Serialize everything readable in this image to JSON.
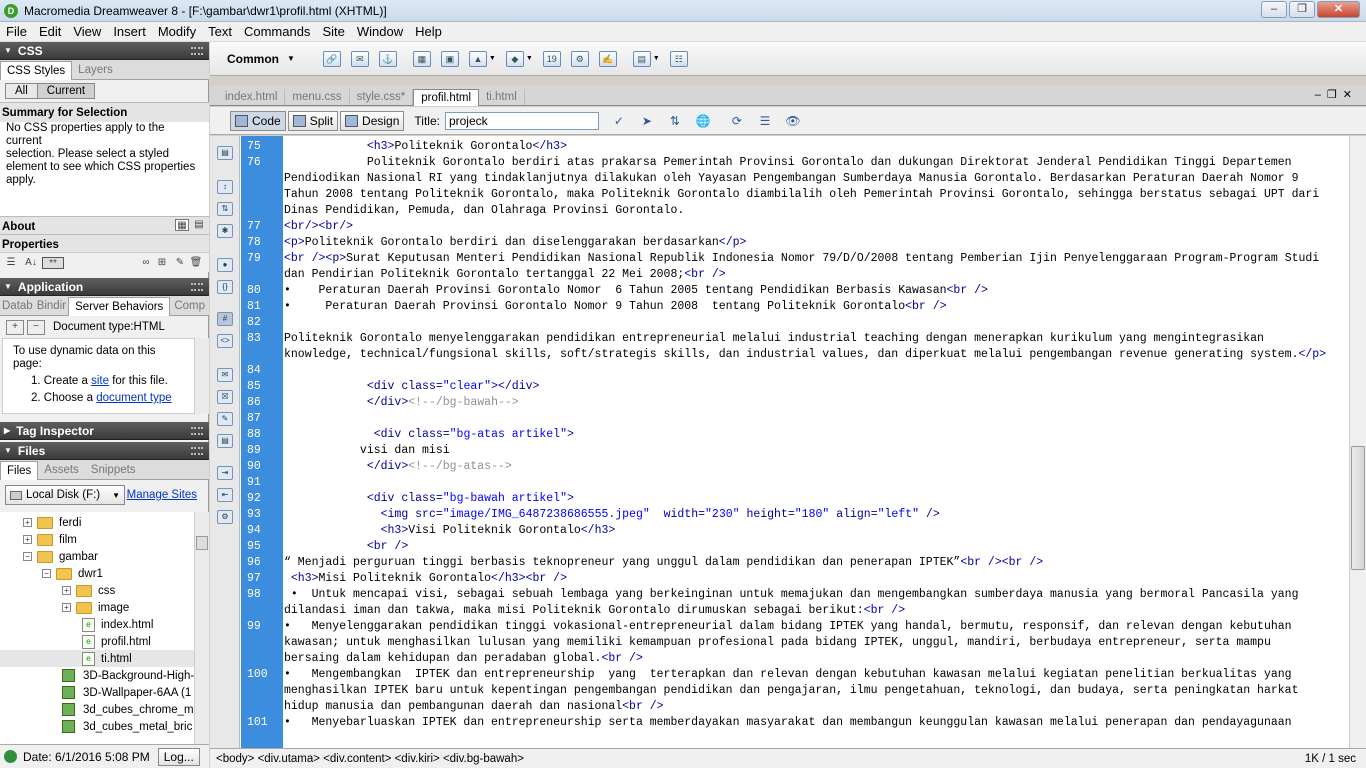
{
  "window": {
    "title": "Macromedia Dreamweaver 8 - [F:\\gambar\\dwr1\\profil.html (XHTML)]"
  },
  "menu": [
    "File",
    "Edit",
    "View",
    "Insert",
    "Modify",
    "Text",
    "Commands",
    "Site",
    "Window",
    "Help"
  ],
  "css_panel": {
    "header": "CSS",
    "tabs": [
      "CSS Styles",
      "Layers"
    ],
    "toggle": [
      "All",
      "Current"
    ],
    "summary_title": "Summary for Selection",
    "summary_lines": [
      "No CSS properties apply to the current",
      "selection.  Please select a styled",
      "element to see which CSS properties",
      "apply."
    ],
    "about": "About",
    "properties": "Properties"
  },
  "application_panel": {
    "header": "Application",
    "tabs": [
      "Datab",
      "Bindir",
      "Server Behaviors",
      "Comp"
    ],
    "doc_type": "Document type:HTML",
    "intro_lines": [
      "To use dynamic data on this",
      "page:"
    ],
    "step1_pre": "1.  Create a ",
    "step1_link": "site",
    "step1_post": " for this file.",
    "step2_pre": "2.  Choose a ",
    "step2_link": "document type"
  },
  "tag_inspector": {
    "header": "Tag Inspector"
  },
  "files_panel": {
    "header": "Files",
    "tabs": [
      "Files",
      "Assets",
      "Snippets"
    ],
    "disk": "Local Disk (F:)",
    "manage_sites": "Manage Sites",
    "tree": [
      "ferdi",
      "film",
      "gambar",
      "dwr1",
      "css",
      "image",
      "index.html",
      "profil.html",
      "ti.html",
      "3D-Background-High-",
      "3D-Wallpaper-6AA (1",
      "3d_cubes_chrome_m",
      "3d_cubes_metal_bric"
    ],
    "date": "Date: 6/1/2016 5:08 PM",
    "log": "Log..."
  },
  "insert_bar": {
    "category": "Common"
  },
  "doc_tabs": [
    "index.html",
    "menu.css",
    "style.css*",
    "profil.html",
    "ti.html"
  ],
  "doc_toolbar": {
    "code": "Code",
    "split": "Split",
    "design": "Design",
    "title_label": "Title:",
    "title_value": "projeck"
  },
  "tag_selector": "<body> <div.utama> <div.content> <div.kiri> <div.bg-bawah>",
  "doc_size": "1K / 1 sec",
  "line_numbers": [
    {
      "n": "75",
      "row": 0
    },
    {
      "n": "76",
      "row": 1
    },
    {
      "n": "77",
      "row": 5
    },
    {
      "n": "78",
      "row": 6
    },
    {
      "n": "79",
      "row": 7
    },
    {
      "n": "80",
      "row": 9
    },
    {
      "n": "81",
      "row": 10
    },
    {
      "n": "82",
      "row": 11
    },
    {
      "n": "83",
      "row": 12
    },
    {
      "n": "84",
      "row": 14
    },
    {
      "n": "85",
      "row": 15
    },
    {
      "n": "86",
      "row": 16
    },
    {
      "n": "87",
      "row": 17
    },
    {
      "n": "88",
      "row": 18
    },
    {
      "n": "89",
      "row": 19
    },
    {
      "n": "90",
      "row": 20
    },
    {
      "n": "91",
      "row": 21
    },
    {
      "n": "92",
      "row": 22
    },
    {
      "n": "93",
      "row": 23
    },
    {
      "n": "94",
      "row": 24
    },
    {
      "n": "95",
      "row": 25
    },
    {
      "n": "96",
      "row": 26
    },
    {
      "n": "97",
      "row": 27
    },
    {
      "n": "98",
      "row": 28
    },
    {
      "n": "99",
      "row": 30
    },
    {
      "n": "100",
      "row": 33
    },
    {
      "n": "101",
      "row": 36
    }
  ],
  "code_lines": [
    "            <h3>Politeknik Gorontalo</h3>",
    "            Politeknik Gorontalo berdiri atas prakarsa Pemerintah Provinsi Gorontalo dan dukungan Direktorat Jenderal Pendidikan Tinggi Departemen",
    "Pendiodikan Nasional RI yang tindaklanjutnya dilakukan oleh Yayasan Pengembangan Sumberdaya Manusia Gorontalo. Berdasarkan Peraturan Daerah Nomor 9",
    "Tahun 2008 tentang Politeknik Gorontalo, maka Politeknik Gorontalo diambilalih oleh Pemerintah Provinsi Gorontalo, sehingga berstatus sebagai UPT dari",
    "Dinas Pendidikan, Pemuda, dan Olahraga Provinsi Gorontalo.",
    "<br/><br/>",
    "<p>Politeknik Gorontalo berdiri dan diselenggarakan berdasarkan</p>",
    "<br /><p>Surat Keputusan Menteri Pendidikan Nasional Republik Indonesia Nomor 79/D/O/2008 tentang Pemberian Ijin Penyelenggaraan Program-Program Studi",
    "dan Pendirian Politeknik Gorontalo tertanggal 22 Mei 2008;<br />",
    "•    Peraturan Daerah Provinsi Gorontalo Nomor  6 Tahun 2005 tentang Pendidikan Berbasis Kawasan<br />",
    "•     Peraturan Daerah Provinsi Gorontalo Nomor 9 Tahun 2008  tentang Politeknik Gorontalo<br />",
    "",
    "Politeknik Gorontalo menyelenggarakan pendidikan entrepreneurial melalui industrial teaching dengan menerapkan kurikulum yang mengintegrasikan",
    "knowledge, technical/fungsional skills, soft/strategis skills, dan industrial values, dan diperkuat melalui pengembangan revenue generating system.</p>",
    "",
    "            <div class=\"clear\"></div>",
    "            </div><!--/bg-bawah-->",
    "",
    "             <div class=\"bg-atas artikel\">",
    "           visi dan misi",
    "            </div><!--/bg-atas-->",
    "",
    "            <div class=\"bg-bawah artikel\">",
    "              <img src=\"image/IMG_6487238686555.jpeg\"  width=\"230\" height=\"180\" align=\"left\" />",
    "              <h3>Visi Politeknik Gorontalo</h3>",
    "            <br />",
    "“ Menjadi perguruan tinggi berbasis teknopreneur yang unggul dalam pendidikan dan penerapan IPTEK”<br /><br />",
    " <h3>Misi Politeknik Gorontalo</h3><br />",
    " •  Untuk mencapai visi, sebagai sebuah lembaga yang berkeinginan untuk memajukan dan mengembangkan sumberdaya manusia yang bermoral Pancasila yang",
    "dilandasi iman dan takwa, maka misi Politeknik Gorontalo dirumuskan sebagai berikut:<br />",
    "•   Menyelenggarakan pendidikan tinggi vokasional-entrepreneurial dalam bidang IPTEK yang handal, bermutu, responsif, dan relevan dengan kebutuhan",
    "kawasan; untuk menghasilkan lulusan yang memiliki kemampuan profesional pada bidang IPTEK, unggul, mandiri, berbudaya entrepreneur, serta mampu",
    "bersaing dalam kehidupan dan peradaban global.<br />",
    "•   Mengembangkan  IPTEK dan entrepreneurship  yang  terterapkan dan relevan dengan kebutuhan kawasan melalui kegiatan penelitian berkualitas yang",
    "menghasilkan IPTEK baru untuk kepentingan pengembangan pendidikan dan pengajaran, ilmu pengetahuan, teknologi, dan budaya, serta peningkatan harkat",
    "hidup manusia dan pembangunan daerah dan nasional<br />",
    "•   Menyebarluaskan IPTEK dan entrepreneurship serta memberdayakan masyarakat dan membangun keunggulan kawasan melalui penerapan dan pendayagunaan"
  ],
  "colors": {
    "tag": "#000099",
    "string": "#0000ff",
    "comment": "#909090",
    "gutter": "#3c8dde"
  }
}
